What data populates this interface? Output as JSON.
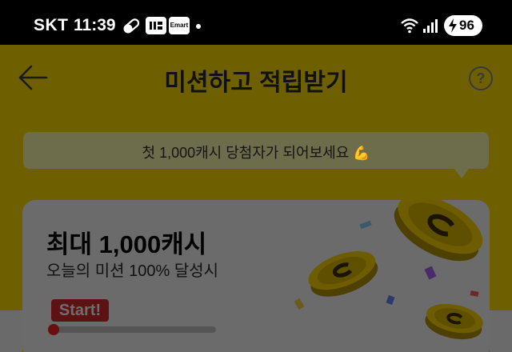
{
  "status_bar": {
    "carrier": "SKT",
    "time": "11:39",
    "app1": "",
    "app2": "Emart",
    "battery": "96"
  },
  "header": {
    "title": "미션하고 적립받기",
    "help_symbol": "?"
  },
  "bubble": {
    "text": "첫 1,000캐시 당첨자가 되어보세요",
    "emoji": "💪"
  },
  "card": {
    "title": "최대 1,000캐시",
    "subtitle": "오늘의 미션 100% 달성시",
    "start_label": "Start!",
    "progress": 0.0
  },
  "icons": {
    "back": "arrow-left-icon",
    "help": "question-circle-icon",
    "coin": "coin-icon"
  },
  "colors": {
    "background_dimmed": "#6e6000",
    "card_dimmed": "#6b6b6b",
    "start_badge": "#5c1212"
  }
}
